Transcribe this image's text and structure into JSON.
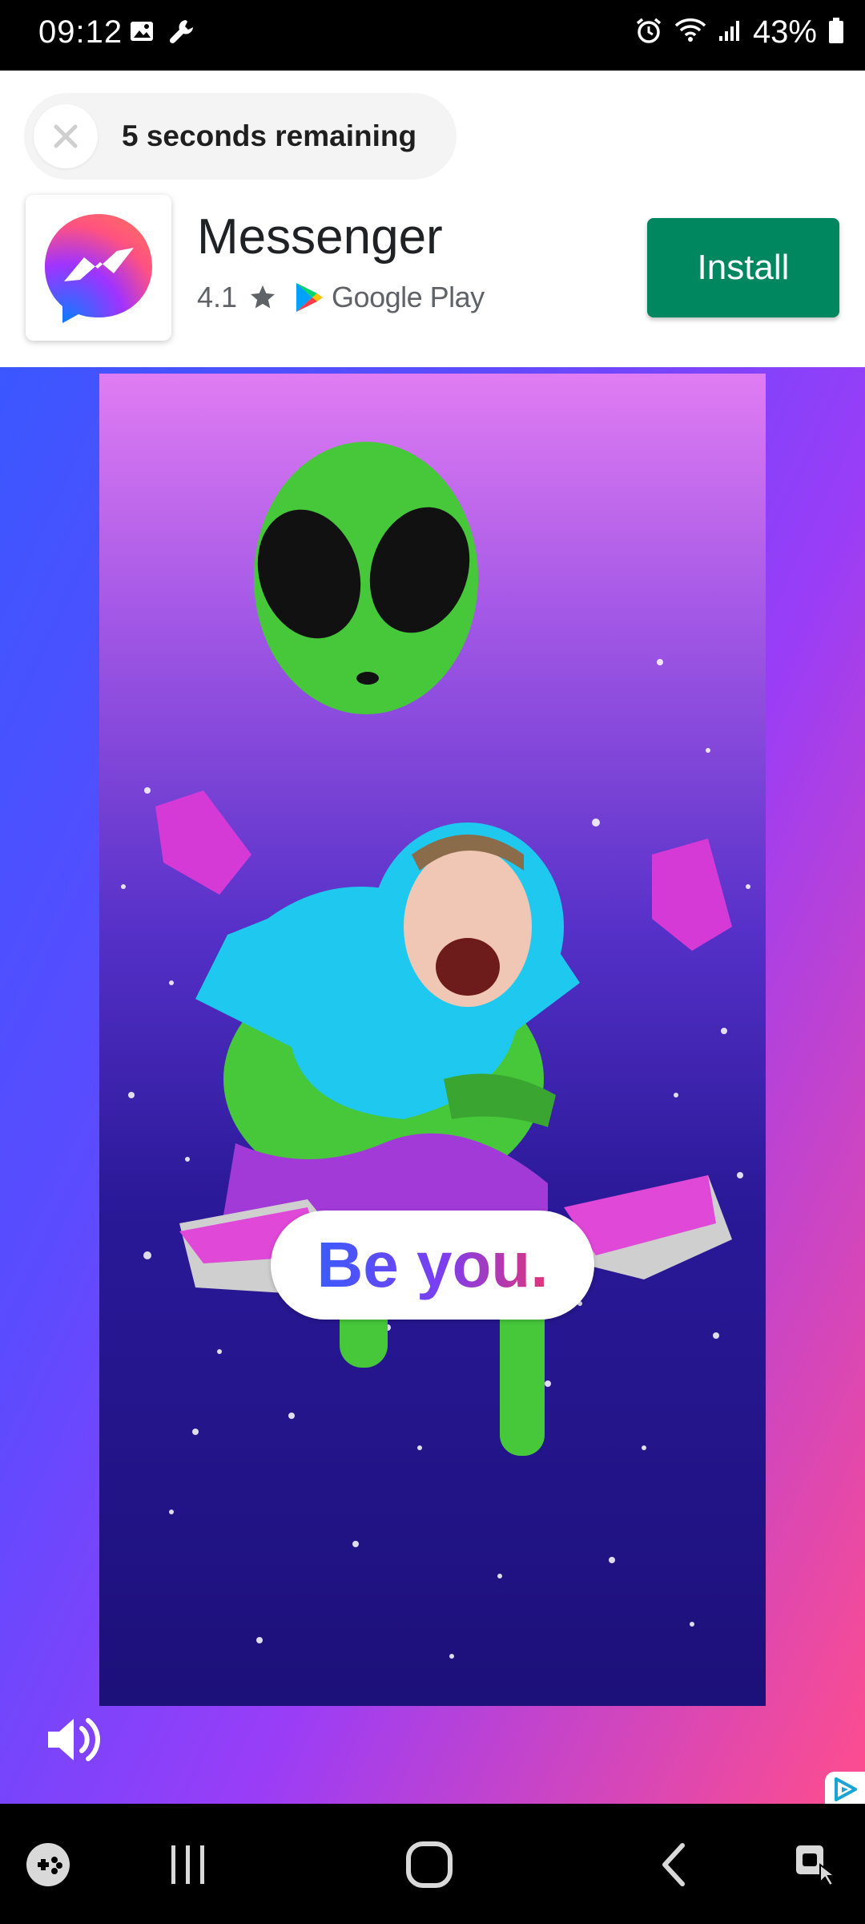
{
  "status_bar": {
    "time": "09:12",
    "battery": "43%",
    "icons": [
      "gallery-icon",
      "wrench-icon",
      "alarm-icon",
      "wifi-icon",
      "signal-icon",
      "battery-icon"
    ]
  },
  "ad": {
    "countdown": "5 seconds remaining",
    "app": {
      "name": "Messenger",
      "rating": "4.1",
      "store": "Google Play",
      "icon": "messenger-logo"
    },
    "install_label": "Install",
    "install_color": "#01875f",
    "media_caption": "Be you.",
    "media_icons": [
      "volume-icon",
      "adchoices-icon"
    ]
  },
  "nav_bar": {
    "items": [
      "game-launcher-icon",
      "recents-icon",
      "home-icon",
      "back-icon",
      "accessibility-icon"
    ]
  }
}
